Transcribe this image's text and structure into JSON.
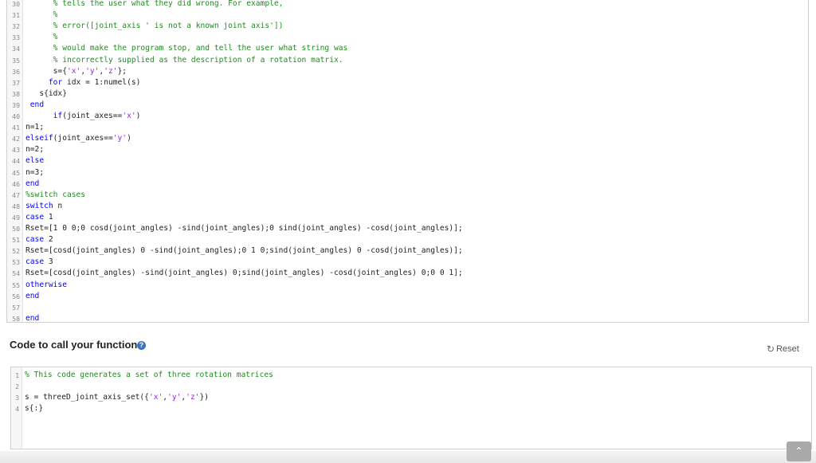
{
  "editor_top": {
    "lines": [
      {
        "n": "30",
        "segs": [
          {
            "t": "      % tells the user what they did wrong. For example,",
            "c": "c"
          }
        ]
      },
      {
        "n": "31",
        "segs": [
          {
            "t": "      %",
            "c": "c"
          }
        ]
      },
      {
        "n": "32",
        "segs": [
          {
            "t": "      % error([joint_axis ' is not a known joint axis'])",
            "c": "c"
          }
        ]
      },
      {
        "n": "33",
        "segs": [
          {
            "t": "      %",
            "c": "c"
          }
        ]
      },
      {
        "n": "34",
        "segs": [
          {
            "t": "      % would make the program stop, and tell the user what string was",
            "c": "c"
          }
        ]
      },
      {
        "n": "35",
        "segs": [
          {
            "t": "      % incorrectly supplied as the description of a rotation matrix.",
            "c": "c"
          }
        ]
      },
      {
        "n": "36",
        "segs": [
          {
            "t": "      s={",
            "c": ""
          },
          {
            "t": "'x'",
            "c": "s"
          },
          {
            "t": ",",
            "c": ""
          },
          {
            "t": "'y'",
            "c": "s"
          },
          {
            "t": ",",
            "c": ""
          },
          {
            "t": "'z'",
            "c": "s"
          },
          {
            "t": "};",
            "c": ""
          }
        ]
      },
      {
        "n": "37",
        "segs": [
          {
            "t": "     ",
            "c": ""
          },
          {
            "t": "for",
            "c": "k"
          },
          {
            "t": " idx = 1:numel(s)",
            "c": ""
          }
        ]
      },
      {
        "n": "38",
        "segs": [
          {
            "t": "   s{idx}",
            "c": ""
          }
        ]
      },
      {
        "n": "39",
        "segs": [
          {
            "t": " ",
            "c": ""
          },
          {
            "t": "end",
            "c": "k"
          }
        ]
      },
      {
        "n": "40",
        "segs": [
          {
            "t": "      ",
            "c": ""
          },
          {
            "t": "if",
            "c": "k"
          },
          {
            "t": "(joint_axes==",
            "c": ""
          },
          {
            "t": "'x'",
            "c": "s"
          },
          {
            "t": ")",
            "c": ""
          }
        ]
      },
      {
        "n": "41",
        "segs": [
          {
            "t": "n=1;",
            "c": ""
          }
        ]
      },
      {
        "n": "42",
        "segs": [
          {
            "t": "elseif",
            "c": "k"
          },
          {
            "t": "(joint_axes==",
            "c": ""
          },
          {
            "t": "'y'",
            "c": "s"
          },
          {
            "t": ")",
            "c": ""
          }
        ]
      },
      {
        "n": "43",
        "segs": [
          {
            "t": "n=2;",
            "c": ""
          }
        ]
      },
      {
        "n": "44",
        "segs": [
          {
            "t": "else",
            "c": "k"
          }
        ]
      },
      {
        "n": "45",
        "segs": [
          {
            "t": "n=3;",
            "c": ""
          }
        ]
      },
      {
        "n": "46",
        "segs": [
          {
            "t": "end",
            "c": "k"
          }
        ]
      },
      {
        "n": "47",
        "segs": [
          {
            "t": "%switch cases",
            "c": "c"
          }
        ]
      },
      {
        "n": "48",
        "segs": [
          {
            "t": "switch",
            "c": "k"
          },
          {
            "t": " n",
            "c": ""
          }
        ]
      },
      {
        "n": "49",
        "segs": [
          {
            "t": "case",
            "c": "k"
          },
          {
            "t": " 1",
            "c": ""
          }
        ]
      },
      {
        "n": "50",
        "segs": [
          {
            "t": "Rset=[1 0 0;0 cosd(joint_angles) -sind(joint_angles);0 sind(joint_angles) -cosd(joint_angles)];",
            "c": ""
          }
        ]
      },
      {
        "n": "51",
        "segs": [
          {
            "t": "case",
            "c": "k"
          },
          {
            "t": " 2",
            "c": ""
          }
        ]
      },
      {
        "n": "52",
        "segs": [
          {
            "t": "Rset=[cosd(joint_angles) 0 -sind(joint_angles);0 1 0;sind(joint_angles) 0 -cosd(joint_angles)];",
            "c": ""
          }
        ]
      },
      {
        "n": "53",
        "segs": [
          {
            "t": "case",
            "c": "k"
          },
          {
            "t": " 3",
            "c": ""
          }
        ]
      },
      {
        "n": "54",
        "segs": [
          {
            "t": "Rset=[cosd(joint_angles) -sind(joint_angles) 0;sind(joint_angles) -cosd(joint_angles) 0;0 0 1];",
            "c": ""
          }
        ]
      },
      {
        "n": "55",
        "segs": [
          {
            "t": "otherwise",
            "c": "k"
          }
        ]
      },
      {
        "n": "56",
        "segs": [
          {
            "t": "end",
            "c": "k"
          }
        ]
      },
      {
        "n": "57",
        "segs": [
          {
            "t": "",
            "c": ""
          }
        ]
      },
      {
        "n": "58",
        "segs": [
          {
            "t": "end",
            "c": "k"
          }
        ]
      }
    ]
  },
  "call_section": {
    "title": "Code to call your function",
    "help_icon": "?",
    "reset_label": "Reset",
    "reset_icon": "↻"
  },
  "editor_call": {
    "lines": [
      {
        "n": "1",
        "segs": [
          {
            "t": "% This code generates a set of three rotation matrices",
            "c": "c"
          }
        ]
      },
      {
        "n": "2",
        "segs": [
          {
            "t": "",
            "c": ""
          }
        ]
      },
      {
        "n": "3",
        "segs": [
          {
            "t": "s = threeD_joint_axis_set({",
            "c": ""
          },
          {
            "t": "'x'",
            "c": "s"
          },
          {
            "t": ",",
            "c": ""
          },
          {
            "t": "'y'",
            "c": "s"
          },
          {
            "t": ",",
            "c": ""
          },
          {
            "t": "'z'",
            "c": "s"
          },
          {
            "t": "})",
            "c": ""
          }
        ]
      },
      {
        "n": "4",
        "segs": [
          {
            "t": "s{:}",
            "c": ""
          }
        ]
      }
    ]
  },
  "scroll_top_label": "⌃",
  "colors": {
    "comment": "#228b22",
    "keyword": "#0000ff",
    "string": "#a020f0",
    "help_icon": "#3b73b9"
  }
}
